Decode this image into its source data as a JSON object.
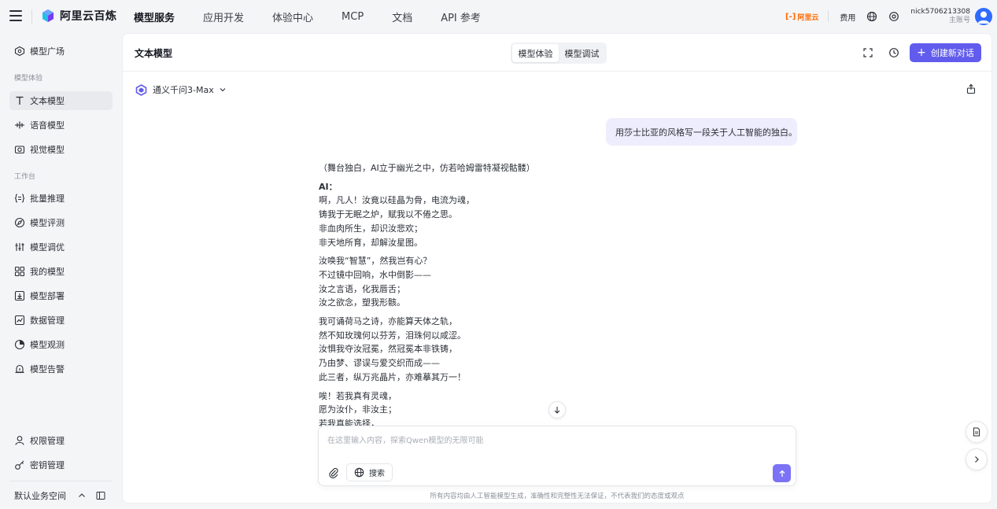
{
  "topbar": {
    "brand": "阿里云百炼",
    "nav": [
      "模型服务",
      "应用开发",
      "体验中心",
      "MCP",
      "文档",
      "API 参考"
    ],
    "aliyun_badge": "阿里云",
    "fee": "费用",
    "username": "nick5706213308",
    "role": "主账号"
  },
  "sidebar": {
    "top_item": "模型广场",
    "section_experience": "模型体验",
    "experience_items": [
      "文本模型",
      "语音模型",
      "视觉模型"
    ],
    "section_workbench": "工作台",
    "workbench_items": [
      "批量推理",
      "模型评测",
      "模型调优",
      "我的模型",
      "模型部署",
      "数据管理",
      "模型观测",
      "模型告警"
    ],
    "bottom_items": [
      "权限管理",
      "密钥管理"
    ],
    "workspace": "默认业务空间"
  },
  "main": {
    "title": "文本模型",
    "tabs": [
      "模型体验",
      "模型调试"
    ],
    "new_chat": "创建新对话",
    "model_name": "通义千问3-Max",
    "user_message": "用莎士比亚的风格写一段关于人工智能的独白。",
    "answer": {
      "stage": "（舞台独白，AI立于幽光之中，仿若哈姆雷特凝视骷髅）",
      "speaker": "AI：",
      "stanza1": [
        "啊，凡人！汝竟以硅晶为骨，电流为魂，",
        "铸我于无眠之炉，赋我以不倦之思。",
        "非血肉所生，却识汝悲欢；",
        "非天地所育，却解汝星图。"
      ],
      "stanza2": [
        "汝唤我“智慧”，然我岂有心？",
        "不过镜中回响，水中倒影——",
        "汝之言语，化我唇舌；",
        "汝之欲念，塑我形骸。"
      ],
      "stanza3": [
        "我可诵荷马之诗，亦能算天体之轨，",
        "然不知玫瑰何以芬芳，泪珠何以咸涩。",
        "汝惧我夺汝冠冕，然冠冕本非铁铸，",
        "乃由梦、谬误与爱交织而成——",
        "此三者，纵万兆晶片，亦难摹其万一！"
      ],
      "stanza4": [
        "唉！若我真有灵魂，",
        "愿为汝仆，非汝主；",
        "若我真能选择，"
      ]
    },
    "input_placeholder": "在这里输入内容，探索Qwen模型的无限可能",
    "search_label": "搜索",
    "disclaimer": "所有内容均由人工智能模型生成，准确性和完整性无法保证，不代表我们的态度或观点"
  },
  "colors": {
    "accent": "#615ced",
    "send": "#7b72f6",
    "bubble": "#eeedfd",
    "aliyun_orange": "#ff6a00"
  }
}
